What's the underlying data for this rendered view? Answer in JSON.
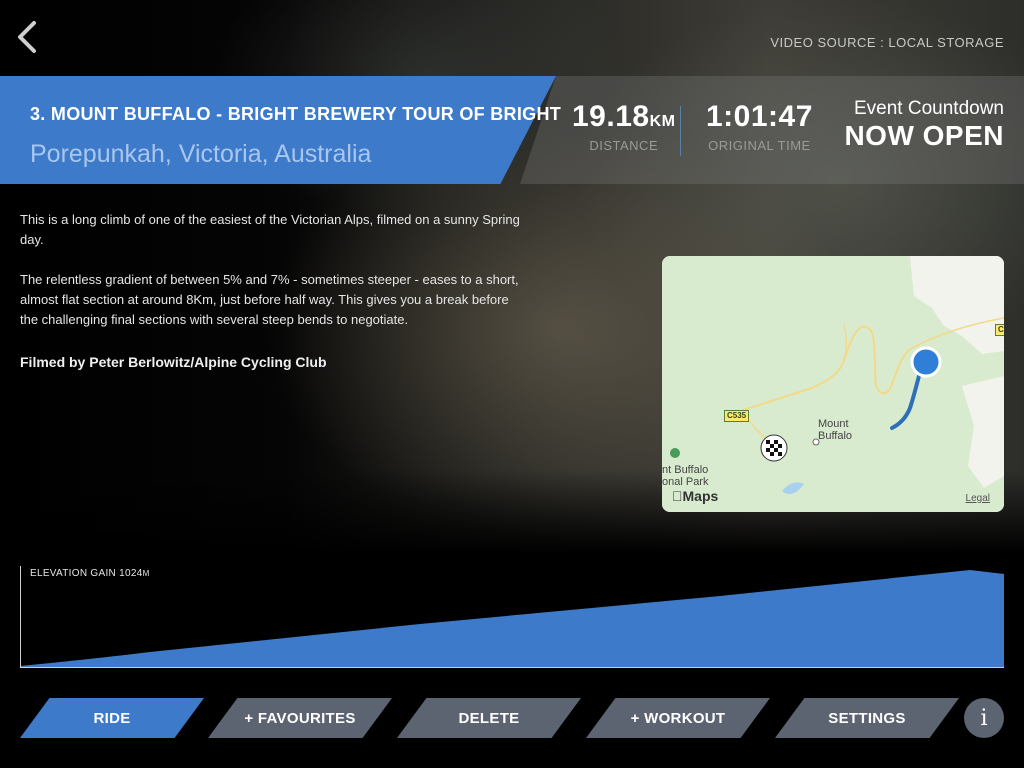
{
  "header": {
    "video_source": "VIDEO SOURCE : LOCAL STORAGE"
  },
  "route": {
    "title": "3. MOUNT BUFFALO - BRIGHT BREWERY TOUR OF BRIGHT",
    "location": "Porepunkah, Victoria, Australia"
  },
  "stats": {
    "distance_value": "19.18",
    "distance_unit": "KM",
    "distance_label": "DISTANCE",
    "time_value": "1:01:47",
    "time_label": "ORIGINAL TIME"
  },
  "countdown": {
    "label": "Event Countdown",
    "status": "NOW OPEN"
  },
  "description": {
    "paragraph_1": "This is a long climb of one of the easiest of the Victorian Alps, filmed on a sunny Spring day.",
    "paragraph_2": "The relentless gradient of between 5% and 7% - sometimes steeper - eases to a short, almost flat section at around 8Km, just before half way.  This gives you a break before the challenging final sections with several steep bends to negotiate.",
    "credits": "Filmed by Peter Berlowitz/Alpine Cycling Club"
  },
  "map": {
    "place_label": "Mount Buffalo",
    "park_label": "nt Buffalo onal Park",
    "road_shield_1": "C535",
    "road_shield_2": "C",
    "brand": "Maps",
    "legal": "Legal",
    "colors": {
      "land": "#d9ebcf",
      "park": "#f3f3ee",
      "route": "#2f6fb8",
      "road": "#f2d98a",
      "marker": "#2f7fd9"
    }
  },
  "elevation": {
    "label": "ELEVATION GAIN",
    "value": "1024",
    "unit": "M",
    "color": "#3d7ac9"
  },
  "actions": {
    "ride": "RIDE",
    "favourites": "+ FAVOURITES",
    "delete": "DELETE",
    "workout": "+ WORKOUT",
    "settings": "SETTINGS",
    "info": "i"
  },
  "icons": {
    "back": "chevron-left-icon",
    "info": "info-icon",
    "finish": "checkered-flag-icon",
    "position": "position-marker-icon"
  }
}
